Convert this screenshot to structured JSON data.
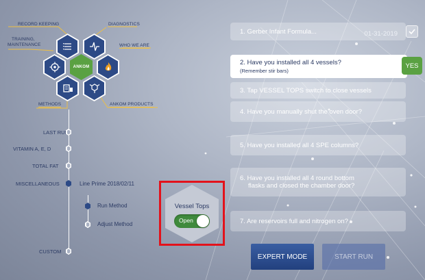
{
  "hex_menu": {
    "brand": "ANKOM",
    "labels": {
      "record_keeping": "RECORD KEEPING",
      "diagnostics": "DIAGNOSTICS",
      "training": "TRAINING,",
      "maintenance": "MAINTENANCE",
      "who_we_are": "WHO WE ARE",
      "methods": "METHODS",
      "ankom_products": "ANKOM PRODUCTS"
    }
  },
  "timeline": {
    "items": [
      {
        "label": "LAST RUN"
      },
      {
        "label": "VITAMIN A, E, D"
      },
      {
        "label": "TOTAL FAT"
      },
      {
        "label": "MISCELLANEOUS",
        "detail": "Line Prime 2018/02/11"
      },
      {
        "label": "CUSTOM"
      }
    ],
    "sub_items": [
      {
        "label": "Run Method"
      },
      {
        "label": "Adjust Method"
      }
    ]
  },
  "vessel_tops": {
    "label": "Vessel Tops",
    "toggle_text": "Open"
  },
  "checklist": {
    "steps": [
      {
        "text": "1. Gerber Infant Formula...",
        "date": "01-31-2019"
      },
      {
        "text": "2. Have you installed all 4 vessels?",
        "sub": "(Remember stir bars)"
      },
      {
        "text": "3. Tap VESSEL TOPS switch to close vessels"
      },
      {
        "text": "4. Have you manually shut the oven door?"
      },
      {
        "text": "5. Have you installed all 4 SPE columns?"
      },
      {
        "text": "6. Have you installed all 4 round bottom",
        "text2": "flasks and closed the chamber door?"
      },
      {
        "text": "7. Are reservoirs full and nitrogen on?"
      }
    ],
    "yes_label": "YES"
  },
  "buttons": {
    "expert_mode": "EXPERT MODE",
    "start_run": "START RUN"
  },
  "colors": {
    "hex_blue": "#2d4a86",
    "brand_green": "#5aa142",
    "highlight_red": "#e3121b",
    "toggle_green": "#3f8a3c"
  },
  "icons": [
    "list-icon",
    "waveform-icon",
    "flame-icon",
    "settings-hand-icon",
    "methods-icon",
    "molecule-icon",
    "check-icon"
  ]
}
